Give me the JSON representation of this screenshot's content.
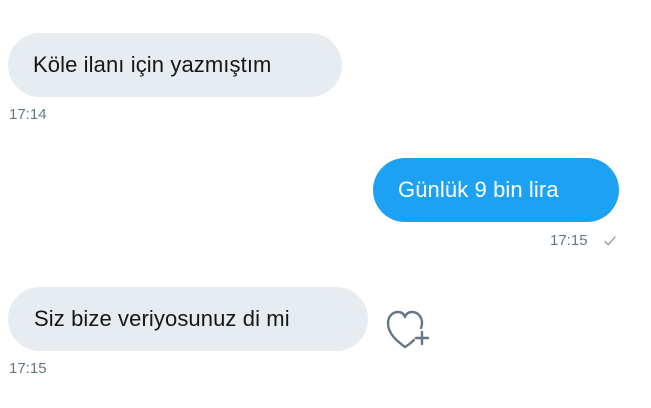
{
  "conversation": {
    "messages": [
      {
        "direction": "incoming",
        "text": "Köle ilanı için yazmıştım",
        "time": "17:14"
      },
      {
        "direction": "outgoing",
        "text": "Günlük 9 bin lira",
        "time": "17:15",
        "status_icon": "check-icon"
      },
      {
        "direction": "incoming",
        "text": "Siz bize veriyosunuz di mi",
        "time": "17:15",
        "reaction_icon": "heart-add-icon"
      }
    ]
  },
  "colors": {
    "incoming_bubble": "#e6ecf0",
    "outgoing_bubble": "#1da1f2",
    "incoming_text": "#14171a",
    "outgoing_text": "#ffffff",
    "timestamp": "#657786",
    "icon": "#657786"
  }
}
